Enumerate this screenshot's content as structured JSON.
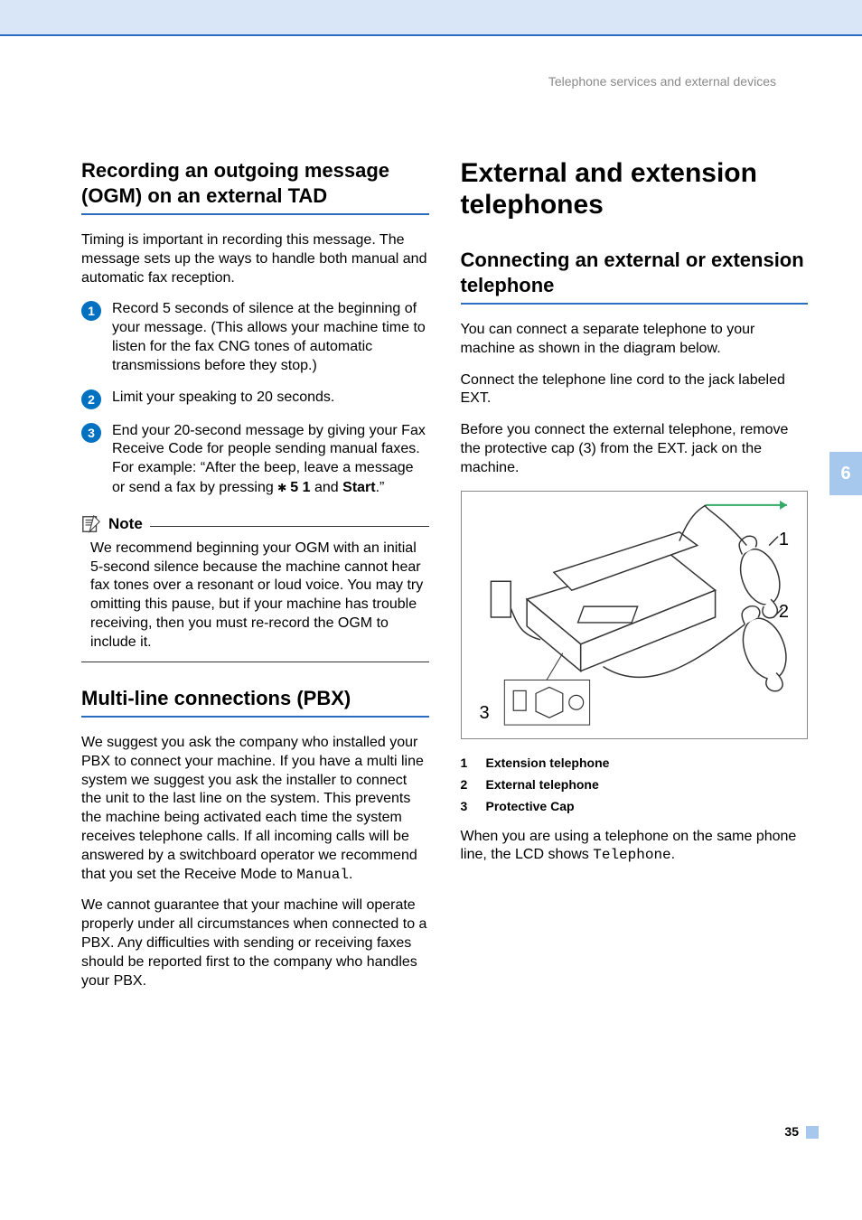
{
  "header": {
    "breadcrumb": "Telephone services and external devices"
  },
  "chapter_tab": "6",
  "page_number": "35",
  "left": {
    "h1": "Recording an outgoing message (OGM) on an external TAD",
    "intro": "Timing is important in recording this message. The message sets up the ways to handle both manual and automatic fax reception.",
    "steps": {
      "s1": "Record 5 seconds of silence at the beginning of your message. (This allows your machine time to listen for the fax CNG tones of automatic transmissions before they stop.)",
      "s2": "Limit your speaking to 20 seconds.",
      "s3_a": "End your 20-second message by giving your Fax Receive Code for people sending manual faxes. For example: “After the beep, leave a message or send a fax by pressing ",
      "s3_b": " 5 1",
      "s3_c": " and ",
      "s3_d": "Start",
      "s3_e": ".”"
    },
    "note": {
      "label": "Note",
      "body": "We recommend beginning your OGM with an initial 5-second silence because the machine cannot hear fax tones over a resonant or loud voice. You may try omitting this pause, but if your machine has trouble receiving, then you must re-record the OGM to include it."
    },
    "h2": "Multi-line connections (PBX)",
    "pbx_p1_a": "We suggest you ask the company who installed your PBX to connect your machine. If you have a multi line system we suggest you ask the installer to connect the unit to the last line on the system. This prevents the machine being activated each time the system receives telephone calls. If all incoming calls will be answered by a switchboard operator we recommend that you set the Receive Mode to ",
    "pbx_p1_b": "Manual",
    "pbx_p1_c": ".",
    "pbx_p2": "We cannot guarantee that your machine will operate properly under all circumstances when connected to a PBX. Any difficulties with sending or receiving faxes should be reported first to the company who handles your PBX."
  },
  "right": {
    "title": "External and extension telephones",
    "h1": "Connecting an external or extension telephone",
    "p1": "You can connect a separate telephone to your machine as shown in the diagram below.",
    "p2": "Connect the telephone line cord to the jack labeled EXT.",
    "p3": "Before you connect the external telephone, remove the protective cap (3) from the EXT. jack on the machine.",
    "callouts": {
      "c1": "1",
      "c2": "2",
      "c3": "3"
    },
    "legend": {
      "l1": {
        "n": "1",
        "t": "Extension telephone"
      },
      "l2": {
        "n": "2",
        "t": "External telephone"
      },
      "l3": {
        "n": "3",
        "t": "Protective Cap"
      }
    },
    "p4_a": "When you are using a telephone on the same phone line, the LCD shows ",
    "p4_b": "Telephone",
    "p4_c": "."
  }
}
